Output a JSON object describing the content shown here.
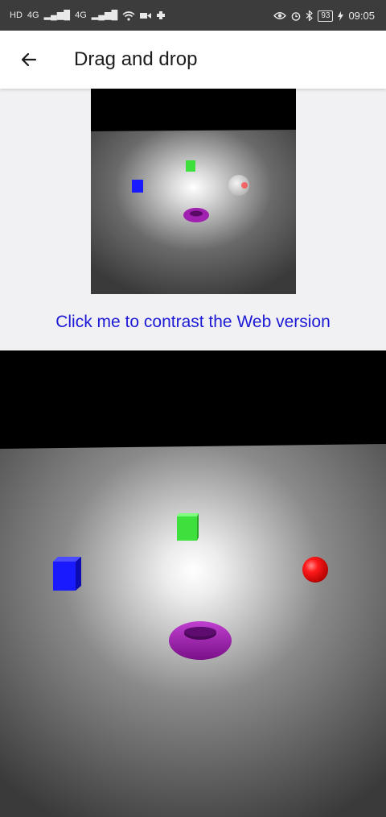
{
  "status_bar": {
    "left_glyphs": [
      "HD",
      "4G",
      "▂▄▆█",
      "4G",
      "▂▄▆█"
    ],
    "battery": "93",
    "time": "09:05"
  },
  "app_bar": {
    "back_icon": "arrow-back-icon",
    "title": "Drag and drop"
  },
  "link": {
    "label": "Click me to contrast the Web version"
  },
  "scene": {
    "objects": [
      {
        "name": "green-cube",
        "color": "#3ee03e"
      },
      {
        "name": "blue-cube",
        "color": "#1a1aff"
      },
      {
        "name": "red-sphere",
        "color": "#ff1a1a"
      },
      {
        "name": "purple-torus",
        "color": "#a020b0"
      }
    ]
  }
}
